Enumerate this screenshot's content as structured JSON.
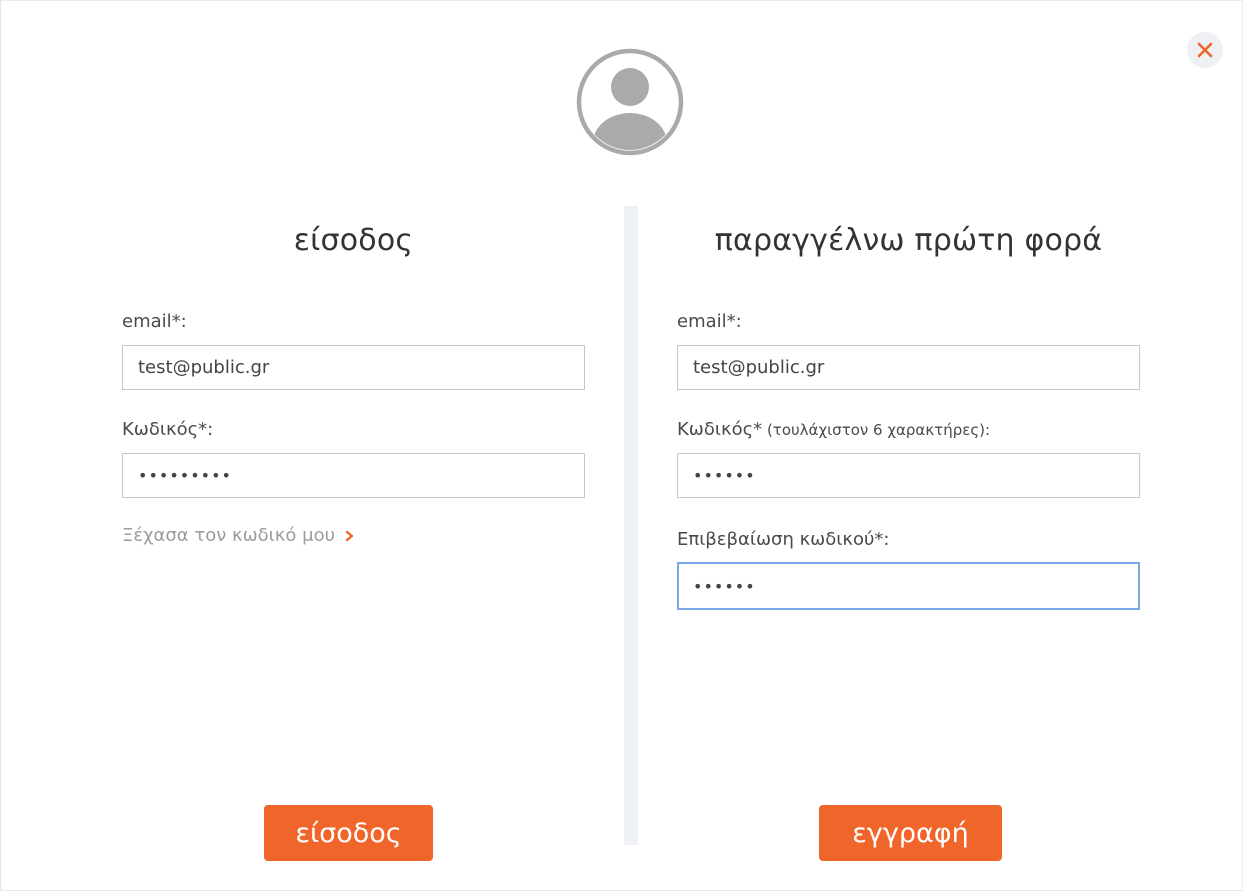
{
  "colors": {
    "accent": "#f0652a",
    "divider": "#eef1f5",
    "focus_border": "#7aa7e6",
    "close_bg": "#eef0f3",
    "avatar": "#aaaaaa"
  },
  "header": {
    "close_icon": "close-icon",
    "avatar_icon": "user-avatar-icon"
  },
  "login": {
    "title": "είσοδος",
    "email_label": "email*:",
    "email_value": "test@public.gr",
    "password_label": "Κωδικός*:",
    "password_value": "123456789",
    "forgot_link": "Ξέχασα τον κωδικό μου",
    "forgot_icon": "chevron-right-icon",
    "submit_label": "είσοδος"
  },
  "register": {
    "title": "παραγγέλνω πρώτη φορά",
    "email_label": "email*:",
    "email_value": "test@public.gr",
    "password_label": "Κωδικός*",
    "password_hint": " (τουλάχιστον 6 χαρακτήρες):",
    "password_value": "123456",
    "confirm_label": "Επιβεβαίωση κωδικού*:",
    "confirm_value": "123456",
    "submit_label": "εγγραφή"
  }
}
